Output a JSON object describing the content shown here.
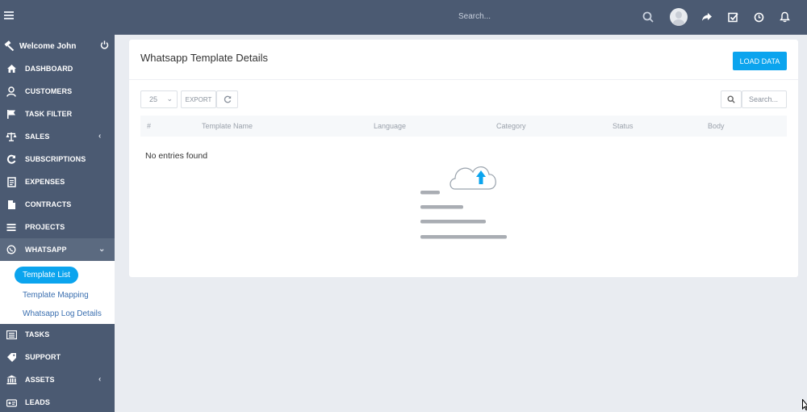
{
  "topbar": {
    "search_placeholder": "Search...",
    "icons": [
      "menu-icon",
      "search-icon",
      "avatar",
      "share-icon",
      "checkbox-icon",
      "clock-icon",
      "bell-icon"
    ]
  },
  "sidebar": {
    "welcome": "Welcome John",
    "items": [
      {
        "label": "DASHBOARD",
        "icon": "home-icon"
      },
      {
        "label": "CUSTOMERS",
        "icon": "user-icon"
      },
      {
        "label": "TASK FILTER",
        "icon": "flag-icon"
      },
      {
        "label": "SALES",
        "icon": "scale-icon"
      },
      {
        "label": "SUBSCRIPTIONS",
        "icon": "refresh-icon"
      },
      {
        "label": "EXPENSES",
        "icon": "document-icon"
      },
      {
        "label": "CONTRACTS",
        "icon": "file-icon"
      },
      {
        "label": "PROJECTS",
        "icon": "bars-icon"
      },
      {
        "label": "WHATSAPP",
        "icon": "whatsapp-icon"
      },
      {
        "label": "TASKS",
        "icon": "tasks-icon"
      },
      {
        "label": "SUPPORT",
        "icon": "ticket-icon"
      },
      {
        "label": "ASSETS",
        "icon": "bank-icon"
      },
      {
        "label": "LEADS",
        "icon": "leads-icon"
      }
    ],
    "whatsapp_sub": [
      "Template List",
      "Template Mapping",
      "Whatsapp Log Details"
    ]
  },
  "main": {
    "title": "Whatsapp Template Details",
    "load_button": "LOAD DATA",
    "page_size": "25",
    "export_label": "EXPORT",
    "search_placeholder": "Search...",
    "columns": [
      "#",
      "Template Name",
      "Language",
      "Category",
      "Status",
      "Body"
    ],
    "empty_message": "No entries found"
  },
  "colors": {
    "sidebar_bg": "#4b5a72",
    "accent": "#0ba4ee",
    "page_bg": "#e9ecf1"
  }
}
